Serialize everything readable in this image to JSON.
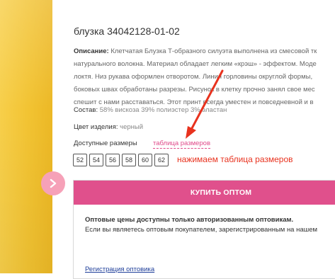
{
  "product": {
    "title": "блузка 34042128-01-02",
    "description_label": "Описание:",
    "description_lines": [
      " Клетчатая Блузка Т-образного силуэта выполнена из смесовой тк",
      "натурального волокна. Материал обладает легким «крэш» - эффектом. Моде",
      "локтя. Низ рукава оформлен отворотом. Линия горловины округлой формы,",
      "боковых швах обработаны разрезы. Рисунок в клетку прочно занял свое мес",
      "спешит с нами расставаться. Этот принт всегда уместен и повседневной и в"
    ],
    "composition_label": "Состав:",
    "composition_value": " 58% вискоза 39% полиэстер 3% эластан",
    "color_label": "Цвет изделия:",
    "color_value": " черный",
    "sizes_label": "Доступные размеры",
    "size_chart_link": "таблица размеров",
    "sizes": [
      "52",
      "54",
      "56",
      "58",
      "60",
      "62"
    ]
  },
  "annotation": {
    "hint_text": "нажимаем таблица размеров",
    "color": "#e8321e"
  },
  "wholesale": {
    "buy_button": "КУПИТЬ ОПТОМ",
    "note_bold": "Оптовые цены доступны только авторизованным оптовикам.",
    "note": "Если вы являетесь оптовым покупателем, зарегистрированным на нашем",
    "register_link": "Регистрация оптовика"
  },
  "icons": {
    "gallery_next": "chevron-right-icon"
  },
  "colors": {
    "accent": "#e0508c",
    "link": "#e04a8a",
    "photo": "#f2c332"
  }
}
